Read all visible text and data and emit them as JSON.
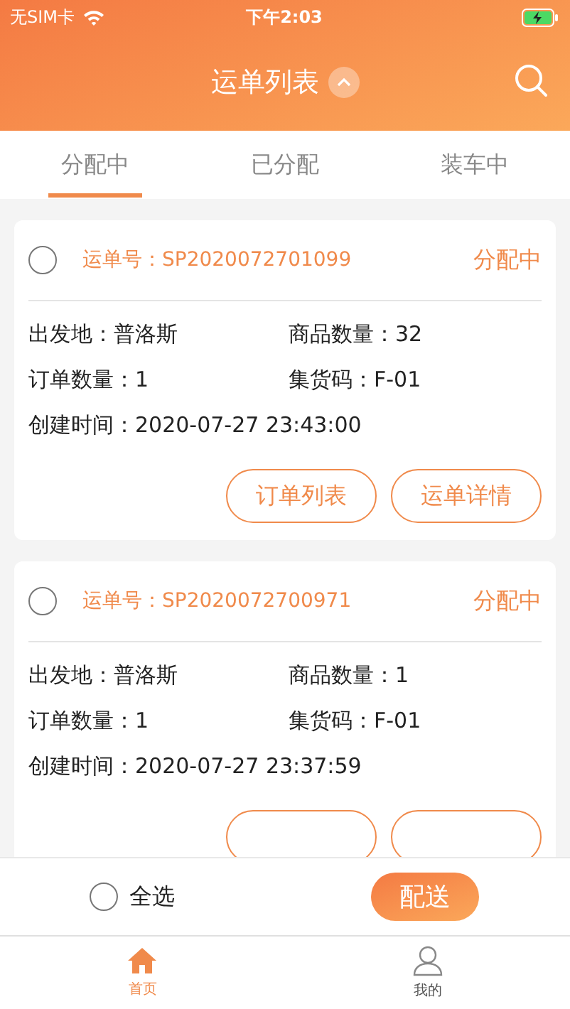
{
  "status_bar": {
    "carrier": "无SIM卡",
    "time": "下午2:03"
  },
  "header": {
    "title": "运单列表"
  },
  "tabs": [
    {
      "label": "分配中",
      "selected": true
    },
    {
      "label": "已分配",
      "selected": false
    },
    {
      "label": "装车中",
      "selected": false
    }
  ],
  "cards": [
    {
      "checked": false,
      "waybill": "运单号：SP2020072701099",
      "status": "分配中",
      "origin": "出发地：普洛斯",
      "goods_count": "商品数量：32",
      "order_count": "订单数量：1",
      "pickup_code": "集货码：F-01",
      "created": "创建时间：2020-07-27 23:43:00",
      "buttons": [
        {
          "kind": "outline",
          "label": "订单列表"
        },
        {
          "kind": "outline",
          "label": "运单详情"
        }
      ]
    },
    {
      "checked": false,
      "waybill": "运单号：SP2020072700971",
      "status": "分配中",
      "origin": "出发地：普洛斯",
      "goods_count": "商品数量：1",
      "order_count": "订单数量：1",
      "pickup_code": "集货码：F-01",
      "created": "创建时间：2020-07-27 23:37:59",
      "buttons": [
        {
          "kind": "outline"
        },
        {
          "kind": "outline"
        }
      ]
    }
  ],
  "footer": {
    "select_all": {
      "label": "全选",
      "checked": false
    },
    "submit": "配送"
  },
  "nav": [
    {
      "label": "首页",
      "kind": "home",
      "selected": true
    },
    {
      "label": "我的",
      "kind": "user",
      "selected": false
    }
  ]
}
